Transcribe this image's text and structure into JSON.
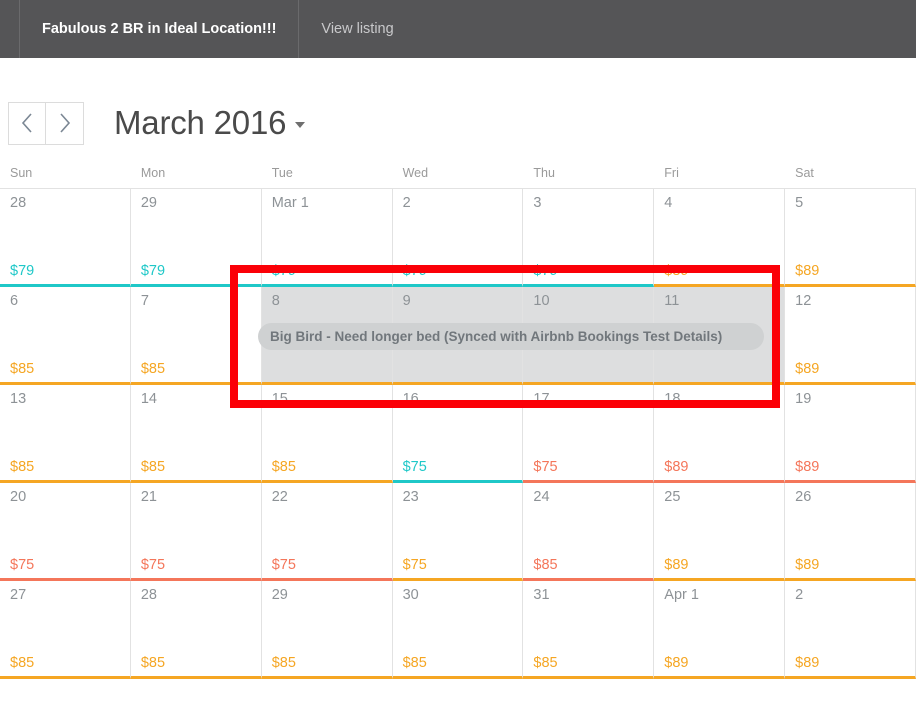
{
  "topbar": {
    "listing_title": "Fabulous 2 BR in Ideal Location!!!",
    "view_listing_label": "View listing"
  },
  "month_header": {
    "prev_label": "‹",
    "next_label": "›",
    "title": "March 2016"
  },
  "weekdays": [
    "Sun",
    "Mon",
    "Tue",
    "Wed",
    "Thu",
    "Fri",
    "Sat"
  ],
  "colors": {
    "teal": "#1fc8c8",
    "orange": "#f5a623",
    "salmon": "#f4765a",
    "booked_cell": "#dddedf",
    "pill_bg": "#cfd1d2",
    "annotation_red": "#fb0007",
    "topbar_bg": "#555557"
  },
  "booking": {
    "label": "Big Bird - Need longer bed (Synced with Airbnb Bookings Test Details)",
    "start_day": "8",
    "end_day": "11"
  },
  "weeks": [
    [
      {
        "daynum": "28",
        "price": "$79",
        "color": "#1fc8c8",
        "booked": false
      },
      {
        "daynum": "29",
        "price": "$79",
        "color": "#1fc8c8",
        "booked": false
      },
      {
        "daynum": "Mar 1",
        "price": "$79",
        "color": "#1fc8c8",
        "booked": false
      },
      {
        "daynum": "2",
        "price": "$79",
        "color": "#1fc8c8",
        "booked": false
      },
      {
        "daynum": "3",
        "price": "$79",
        "color": "#1fc8c8",
        "booked": false
      },
      {
        "daynum": "4",
        "price": "$89",
        "color": "#f5a623",
        "booked": false
      },
      {
        "daynum": "5",
        "price": "$89",
        "color": "#f5a623",
        "booked": false
      }
    ],
    [
      {
        "daynum": "6",
        "price": "$85",
        "color": "#f5a623",
        "booked": false
      },
      {
        "daynum": "7",
        "price": "$85",
        "color": "#f5a623",
        "booked": false
      },
      {
        "daynum": "8",
        "price": "",
        "color": "#f5a623",
        "booked": true
      },
      {
        "daynum": "9",
        "price": "",
        "color": "#f5a623",
        "booked": true
      },
      {
        "daynum": "10",
        "price": "",
        "color": "#f5a623",
        "booked": true
      },
      {
        "daynum": "11",
        "price": "",
        "color": "#f5a623",
        "booked": true
      },
      {
        "daynum": "12",
        "price": "$89",
        "color": "#f5a623",
        "booked": false
      }
    ],
    [
      {
        "daynum": "13",
        "price": "$85",
        "color": "#f5a623",
        "booked": false
      },
      {
        "daynum": "14",
        "price": "$85",
        "color": "#f5a623",
        "booked": false
      },
      {
        "daynum": "15",
        "price": "$85",
        "color": "#f5a623",
        "booked": false
      },
      {
        "daynum": "16",
        "price": "$75",
        "color": "#1fc8c8",
        "booked": false
      },
      {
        "daynum": "17",
        "price": "$75",
        "color": "#f4765a",
        "booked": false
      },
      {
        "daynum": "18",
        "price": "$89",
        "color": "#f4765a",
        "booked": false
      },
      {
        "daynum": "19",
        "price": "$89",
        "color": "#f4765a",
        "booked": false
      }
    ],
    [
      {
        "daynum": "20",
        "price": "$75",
        "color": "#f4765a",
        "booked": false
      },
      {
        "daynum": "21",
        "price": "$75",
        "color": "#f4765a",
        "booked": false
      },
      {
        "daynum": "22",
        "price": "$75",
        "color": "#f4765a",
        "booked": false
      },
      {
        "daynum": "23",
        "price": "$75",
        "color": "#f5a623",
        "booked": false
      },
      {
        "daynum": "24",
        "price": "$85",
        "color": "#f4765a",
        "booked": false
      },
      {
        "daynum": "25",
        "price": "$89",
        "color": "#f5a623",
        "booked": false
      },
      {
        "daynum": "26",
        "price": "$89",
        "color": "#f5a623",
        "booked": false
      }
    ],
    [
      {
        "daynum": "27",
        "price": "$85",
        "color": "#f5a623",
        "booked": false
      },
      {
        "daynum": "28",
        "price": "$85",
        "color": "#f5a623",
        "booked": false
      },
      {
        "daynum": "29",
        "price": "$85",
        "color": "#f5a623",
        "booked": false
      },
      {
        "daynum": "30",
        "price": "$85",
        "color": "#f5a623",
        "booked": false
      },
      {
        "daynum": "31",
        "price": "$85",
        "color": "#f5a623",
        "booked": false
      },
      {
        "daynum": "Apr 1",
        "price": "$89",
        "color": "#f5a623",
        "booked": false
      },
      {
        "daynum": "2",
        "price": "$89",
        "color": "#f5a623",
        "booked": false
      }
    ]
  ]
}
